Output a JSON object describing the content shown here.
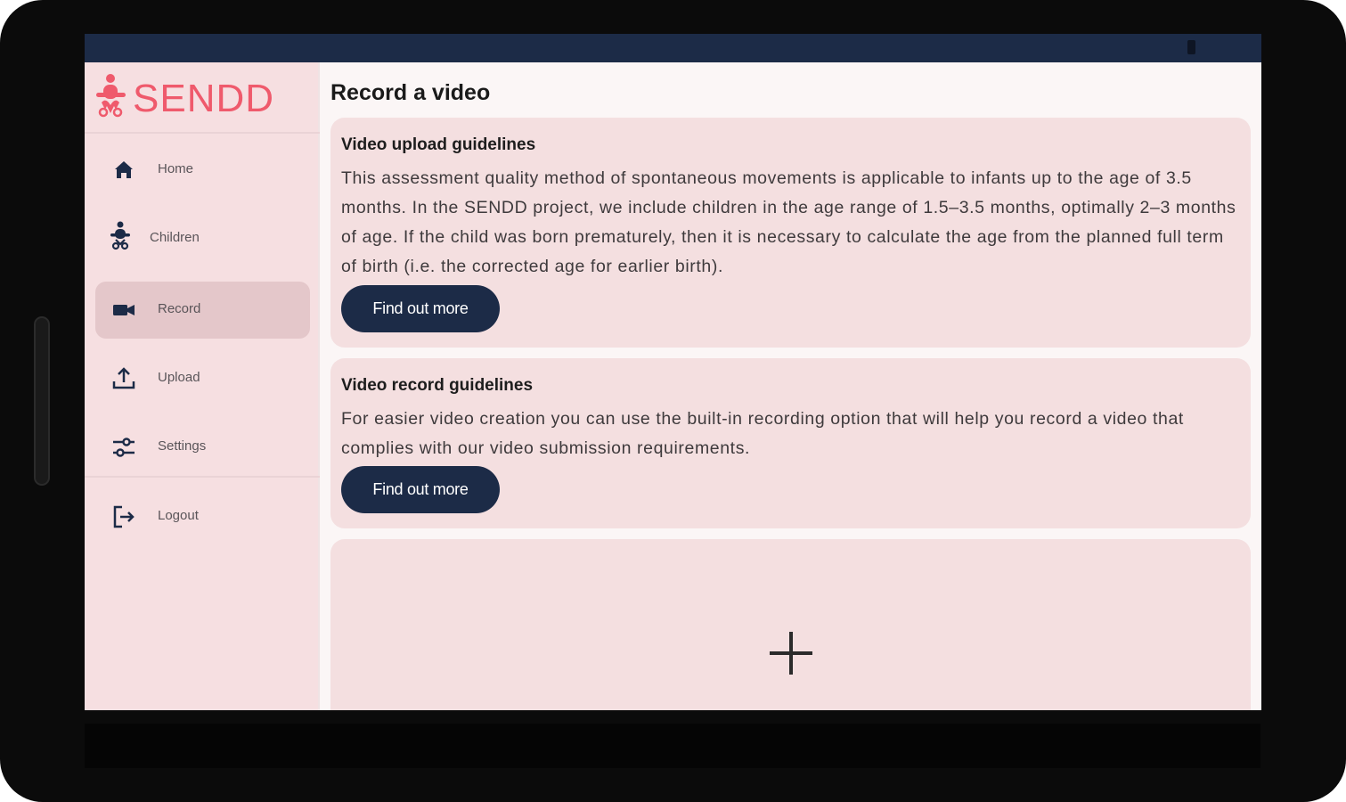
{
  "app": {
    "brand": "SENDD",
    "page_title": "Record a video"
  },
  "sidebar": {
    "items": [
      {
        "label": "Home",
        "icon": "home-icon"
      },
      {
        "label": "Children",
        "icon": "child-icon"
      },
      {
        "label": "Record",
        "icon": "video-camera-icon",
        "active": true
      },
      {
        "label": "Upload",
        "icon": "upload-icon"
      },
      {
        "label": "Settings",
        "icon": "sliders-icon"
      },
      {
        "label": "Logout",
        "icon": "logout-icon"
      }
    ]
  },
  "cards": {
    "upload": {
      "title": "Video upload guidelines",
      "body": "This assessment quality method of spontaneous movements is applicable to infants up to the age of 3.5 months. In the SENDD project, we include children in the age range of 1.5–3.5 months, optimally 2–3 months of age. If the child was born prematurely, then it is necessary to calculate the age from the planned full term of birth (i.e. the corrected age for earlier birth).",
      "button": "Find out more"
    },
    "record": {
      "title": "Video record guidelines",
      "body": "For easier video creation you can use the built-in recording option that will help you record a video that complies with our video submission requirements.",
      "button": "Find out more"
    },
    "new_video": {
      "icon": "plus-icon"
    }
  },
  "colors": {
    "accent": "#ef5a6c",
    "navy": "#1c2b47",
    "sidebar_bg": "#f6dfe1",
    "card_bg": "#f4dfe0"
  }
}
